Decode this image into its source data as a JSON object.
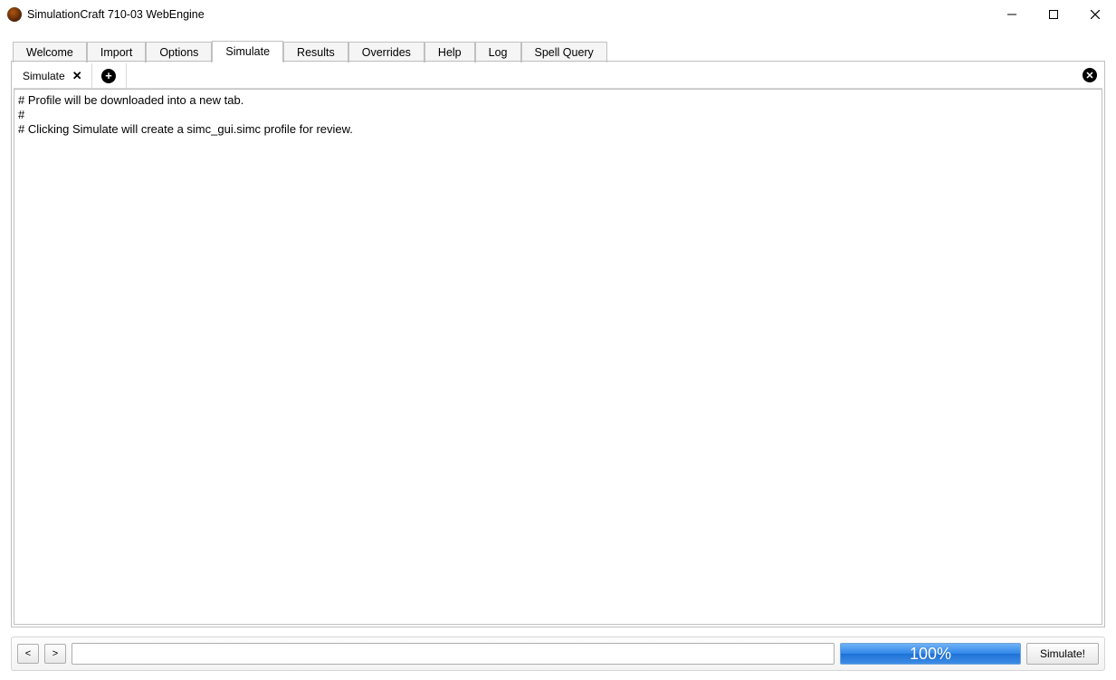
{
  "window": {
    "title": "SimulationCraft 710-03 WebEngine"
  },
  "tabs": {
    "items": [
      {
        "label": "Welcome"
      },
      {
        "label": "Import"
      },
      {
        "label": "Options"
      },
      {
        "label": "Simulate"
      },
      {
        "label": "Results"
      },
      {
        "label": "Overrides"
      },
      {
        "label": "Help"
      },
      {
        "label": "Log"
      },
      {
        "label": "Spell Query"
      }
    ],
    "active_index": 3
  },
  "subtabs": {
    "items": [
      {
        "label": "Simulate"
      }
    ]
  },
  "editor": {
    "text": "# Profile will be downloaded into a new tab.\n#\n# Clicking Simulate will create a simc_gui.simc profile for review."
  },
  "bottom": {
    "back_label": "<",
    "forward_label": ">",
    "url_value": "",
    "progress_text": "100%",
    "simulate_label": "Simulate!"
  }
}
